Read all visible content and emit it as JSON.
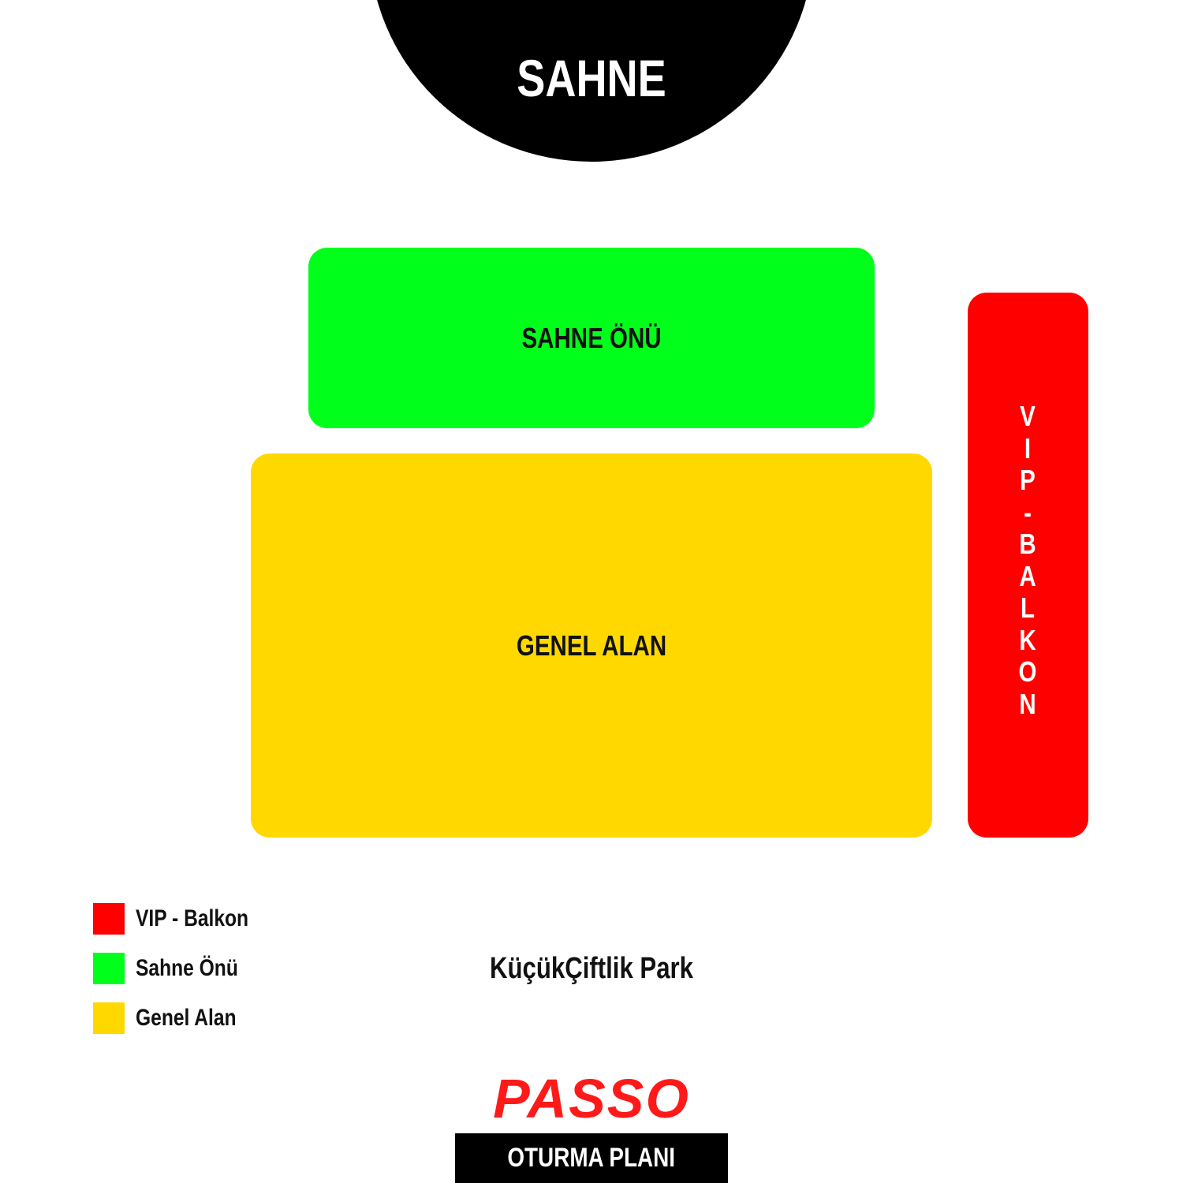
{
  "stage": {
    "label": "SAHNE"
  },
  "zones": {
    "front": {
      "label": "SAHNE ÖNÜ",
      "color": "#00ff1a"
    },
    "general": {
      "label": "GENEL ALAN",
      "color": "#ffd800"
    },
    "vip": {
      "label": "VIP - BALKON",
      "color": "#ff0000",
      "chars": [
        "V",
        "I",
        "P",
        "-",
        "B",
        "A",
        "L",
        "K",
        "O",
        "N"
      ]
    }
  },
  "legend": {
    "items": [
      {
        "label": "VIP - Balkon",
        "color": "#ff0000"
      },
      {
        "label": "Sahne Önü",
        "color": "#00ff1a"
      },
      {
        "label": "Genel Alan",
        "color": "#ffd800"
      }
    ]
  },
  "venue": {
    "name": "KüçükÇiftlik Park"
  },
  "brand": {
    "name": "PASSO",
    "color": "#ff1a1a"
  },
  "footer": {
    "label": "OTURMA PLANI"
  }
}
